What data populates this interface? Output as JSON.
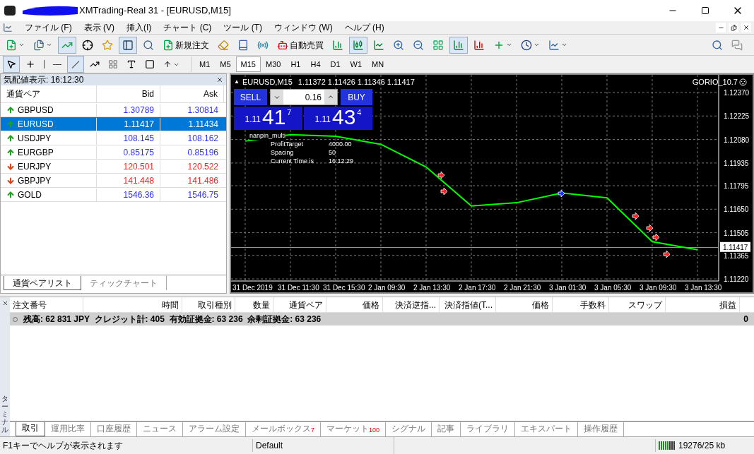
{
  "window": {
    "title": "XMTrading-Real 31 - [EURUSD,M15]"
  },
  "menu": [
    "ファイル (F)",
    "表示 (V)",
    "挿入(I)",
    "チャート (C)",
    "ツール (T)",
    "ウィンドウ (W)",
    "ヘルプ (H)"
  ],
  "toolbar": {
    "new_order": "新規注文",
    "auto_trading": "自動売買"
  },
  "timeframes": [
    {
      "label": "M1",
      "selected": false
    },
    {
      "label": "M5",
      "selected": false
    },
    {
      "label": "M15",
      "selected": true
    },
    {
      "label": "M30",
      "selected": false
    },
    {
      "label": "H1",
      "selected": false
    },
    {
      "label": "H4",
      "selected": false
    },
    {
      "label": "D1",
      "selected": false
    },
    {
      "label": "W1",
      "selected": false
    },
    {
      "label": "MN",
      "selected": false
    }
  ],
  "market_watch": {
    "title": "気配値表示: 16:12:30",
    "columns": [
      "通貨ペア",
      "Bid",
      "Ask"
    ],
    "rows": [
      {
        "symbol": "GBPUSD",
        "bid": "1.30789",
        "ask": "1.30814",
        "rising": true,
        "selected": false
      },
      {
        "symbol": "EURUSD",
        "bid": "1.11417",
        "ask": "1.11434",
        "rising": true,
        "selected": true
      },
      {
        "symbol": "USDJPY",
        "bid": "108.145",
        "ask": "108.162",
        "rising": true,
        "selected": false
      },
      {
        "symbol": "EURGBP",
        "bid": "0.85175",
        "ask": "0.85196",
        "rising": true,
        "selected": false
      },
      {
        "symbol": "EURJPY",
        "bid": "120.501",
        "ask": "120.522",
        "rising": false,
        "selected": false
      },
      {
        "symbol": "GBPJPY",
        "bid": "141.448",
        "ask": "141.486",
        "rising": false,
        "selected": false
      },
      {
        "symbol": "GOLD",
        "bid": "1546.36",
        "ask": "1546.75",
        "rising": true,
        "selected": false
      }
    ],
    "tabs": [
      {
        "label": "通貨ペアリスト",
        "selected": true
      },
      {
        "label": "ティックチャート",
        "selected": false
      }
    ]
  },
  "chart": {
    "marker": "▲",
    "symbol": "EURUSD,M15",
    "ohlc": "1.11372 1.11426 1.11346 1.11417",
    "expert": "GORIO_10.7",
    "one_click": {
      "sell": "SELL",
      "buy": "BUY",
      "lots": "0.16",
      "sell_price": {
        "prefix": "1.11",
        "big": "41",
        "sup": "7"
      },
      "buy_price": {
        "prefix": "1.11",
        "big": "43",
        "sup": "4"
      }
    },
    "current_price": "1.11417",
    "overlay": {
      "name": "nanpin_multi",
      "params": [
        {
          "label": "ProfitTarget",
          "value": "4000.00"
        },
        {
          "label": "Spacing",
          "value": "50"
        },
        {
          "label": "Current Time is",
          "value": "16:12:29"
        }
      ]
    },
    "chart_data": {
      "type": "line",
      "grid": true,
      "ylim": [
        1.1122,
        1.1237
      ],
      "yticks": [
        {
          "value": 1.1237,
          "label": "1.12370"
        },
        {
          "value": 1.12225,
          "label": "1.12225"
        },
        {
          "value": 1.1208,
          "label": "1.12080"
        },
        {
          "value": 1.11935,
          "label": "1.11935"
        },
        {
          "value": 1.11795,
          "label": "1.11795"
        },
        {
          "value": 1.1165,
          "label": "1.11650"
        },
        {
          "value": 1.11505,
          "label": "1.11505"
        },
        {
          "value": 1.11365,
          "label": "1.11365"
        },
        {
          "value": 1.1122,
          "label": "1.11220"
        }
      ],
      "categories": [
        "31 Dec 2019",
        "31 Dec 11:30",
        "31 Dec 15:30",
        "2 Jan 09:30",
        "2 Jan 13:30",
        "2 Jan 17:30",
        "2 Jan 21:30",
        "3 Jan 01:30",
        "3 Jan 05:30",
        "3 Jan 09:30",
        "3 Jan 13:30"
      ],
      "series": [
        {
          "color": "#00ff00",
          "values": [
            1.1207,
            1.1211,
            1.121,
            1.1205,
            1.1191,
            1.1167,
            1.1169,
            1.1175,
            1.1172,
            1.1145,
            1.114
          ]
        }
      ]
    }
  },
  "terminal": {
    "label": "ターミナル",
    "columns": [
      "注文番号",
      "時間",
      "取引種別",
      "数量",
      "通貨ペア",
      "価格",
      "決済逆指...",
      "決済指値(T...",
      "価格",
      "手数料",
      "スワップ",
      "損益"
    ],
    "summary": "残高: 62 831 JPY  クレジット計: 405  有効証拠金: 63 236  余剰証拠金: 63 236",
    "profit": "0",
    "tabs": [
      {
        "label": "取引",
        "selected": true
      },
      {
        "label": "運用比率",
        "selected": false
      },
      {
        "label": "口座履歴",
        "selected": false
      },
      {
        "label": "ニュース",
        "selected": false
      },
      {
        "label": "アラーム設定",
        "selected": false
      },
      {
        "label": "メールボックス",
        "badge": "7",
        "selected": false
      },
      {
        "label": "マーケット",
        "badge": "100",
        "selected": false
      },
      {
        "label": "シグナル",
        "selected": false
      },
      {
        "label": "記事",
        "selected": false
      },
      {
        "label": "ライブラリ",
        "selected": false
      },
      {
        "label": "エキスパート",
        "selected": false
      },
      {
        "label": "操作履歴",
        "selected": false
      }
    ]
  },
  "status_bar": {
    "help": "F1キーでヘルプが表示されます",
    "profile": "Default",
    "traffic": "19276/25 kb"
  }
}
